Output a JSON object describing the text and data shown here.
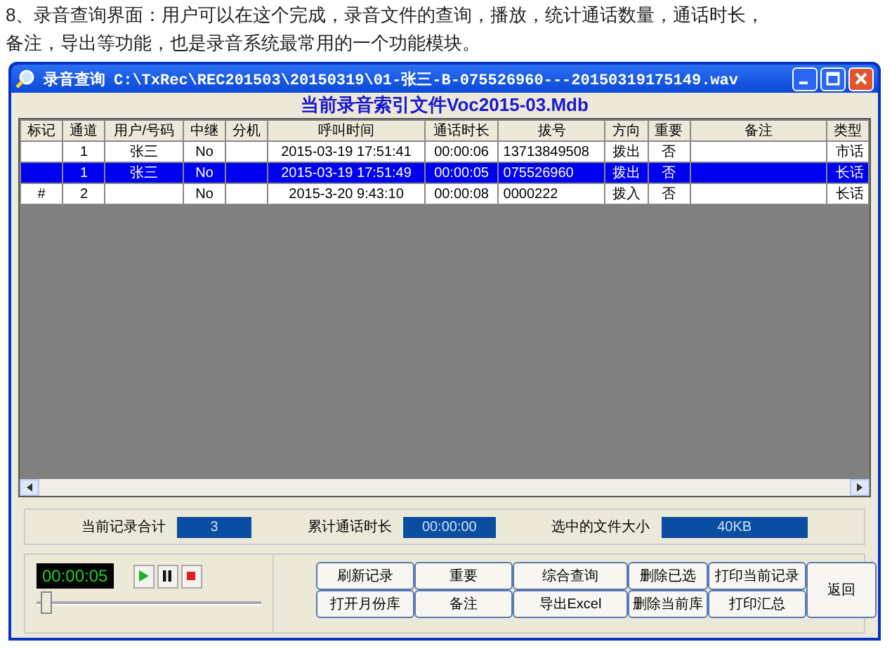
{
  "caption": "8、录音查询界面：用户可以在这个完成，录音文件的查询，播放，统计通话数量，通话时长，备注，导出等功能，也是录音系统最常用的一个功能模块。",
  "window": {
    "app_title": "录音查询",
    "file_path": "C:\\TxRec\\REC201503\\20150319\\01-张三-B-075526960---20150319175149.wav"
  },
  "heading": "当前录音索引文件Voc2015-03.Mdb",
  "table": {
    "columns": [
      "标记",
      "通道",
      "用户/号码",
      "中继",
      "分机",
      "呼叫时间",
      "通话时长",
      "拔号",
      "方向",
      "重要",
      "备注",
      "类型"
    ],
    "rows": [
      {
        "selected": false,
        "channel": "1",
        "user": "张三",
        "trunk": "No",
        "call_time": "2015-03-19 17:51:41",
        "duration": "00:00:06",
        "number": "13713849508",
        "direction": "拨出",
        "important": "否",
        "type": "市话"
      },
      {
        "selected": true,
        "channel": "1",
        "user": "张三",
        "trunk": "No",
        "call_time": "2015-03-19 17:51:49",
        "duration": "00:00:05",
        "number": "075526960",
        "direction": "拨出",
        "important": "否",
        "type": "长话"
      },
      {
        "selected": false,
        "mark": "#",
        "channel": "2",
        "trunk": "No",
        "call_time": "2015-3-20 9:43:10",
        "duration": "00:00:08",
        "number": "0000222",
        "direction": "拨入",
        "important": "否",
        "type": "长话"
      }
    ]
  },
  "stats": [
    {
      "label": "当前记录合计",
      "value": "3"
    },
    {
      "label": "累计通话时长",
      "value": "00:00:00"
    },
    {
      "label": "选中的文件大小",
      "value": "40KB"
    }
  ],
  "player": {
    "time": "00:00:05",
    "level": 0.02
  },
  "buttons": [
    "刷新记录",
    "重要",
    "综合查询",
    "删除已选",
    "打印当前记录",
    "打开月份库",
    "备注",
    "导出Excel",
    "删除当前库",
    "打印汇总"
  ],
  "side_button": "返回"
}
